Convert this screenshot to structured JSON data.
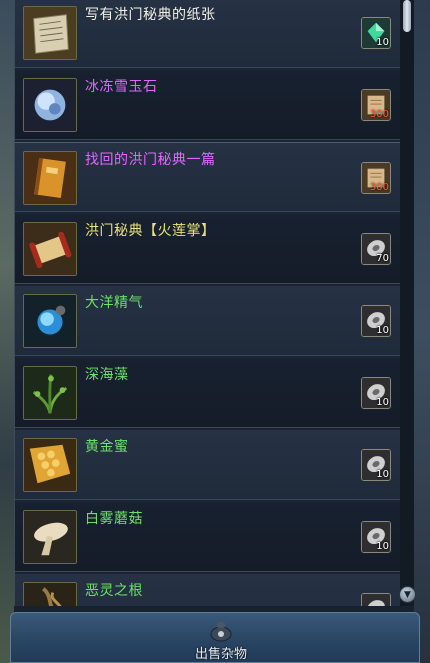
{
  "items": [
    {
      "name": "写有洪门秘典的纸张",
      "cost": "10",
      "cost_icon": "jade-gem-icon",
      "name_color": "white",
      "item_icon": "paper-scroll-icon"
    },
    {
      "name": "冰冻雪玉石",
      "cost": "300",
      "cost_icon": "scroll-currency-icon",
      "name_color": "purple",
      "item_icon": "ice-stone-icon"
    },
    {
      "name": "找回的洪门秘典一篇",
      "cost": "300",
      "cost_icon": "scroll-currency-icon",
      "name_color": "purple",
      "item_icon": "book-icon"
    },
    {
      "name": "洪门秘典【火莲掌】",
      "cost": "70",
      "cost_icon": "silver-coin-icon",
      "name_color": "yellow",
      "item_icon": "red-scroll-icon"
    },
    {
      "name": "大洋精气",
      "cost": "10",
      "cost_icon": "silver-coin-icon",
      "name_color": "green",
      "item_icon": "ocean-essence-icon"
    },
    {
      "name": "深海藻",
      "cost": "10",
      "cost_icon": "silver-coin-icon",
      "name_color": "green",
      "item_icon": "seaweed-icon"
    },
    {
      "name": "黄金蜜",
      "cost": "10",
      "cost_icon": "silver-coin-icon",
      "name_color": "green",
      "item_icon": "honeycomb-icon"
    },
    {
      "name": "白雾蘑菇",
      "cost": "10",
      "cost_icon": "silver-coin-icon",
      "name_color": "green",
      "item_icon": "mushroom-icon"
    },
    {
      "name": "恶灵之根",
      "cost": "",
      "cost_icon": "silver-coin-icon",
      "name_color": "green",
      "item_icon": "root-icon"
    }
  ],
  "footer": {
    "sell_label": "出售杂物"
  },
  "colors": {
    "white": "#f1f1e6",
    "purple": "#e166ff",
    "green": "#6ee06a",
    "yellow": "#e9e37a",
    "cost_red": "#ff5a3a"
  }
}
